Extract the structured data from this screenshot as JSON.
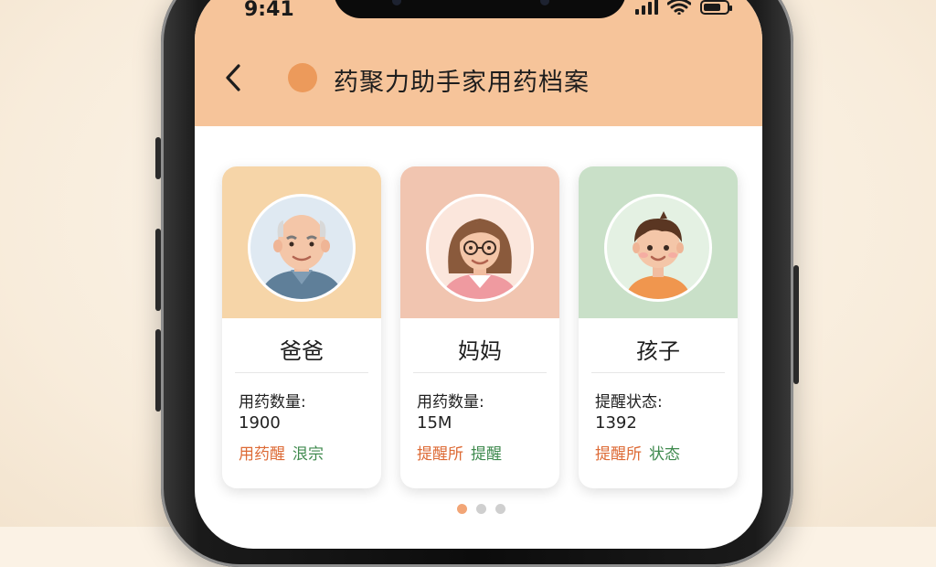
{
  "status_bar": {
    "time": "9:41"
  },
  "header": {
    "title": "药聚力助手家用药档案",
    "accent": "#ec9a5b",
    "background": "#f6c49a"
  },
  "cards": [
    {
      "name": "爸爸",
      "label": "用药数量:",
      "value": "1900",
      "tag_a": "用药醒",
      "tag_b": "泿宗",
      "bg": "#f6d5a8"
    },
    {
      "name": "妈妈",
      "label": "用药数量:",
      "value": "15M",
      "tag_a": "提醒所",
      "tag_b": "提醒",
      "bg": "#f1c5b0"
    },
    {
      "name": "孩子",
      "label": "提醒状态:",
      "value": "1392",
      "tag_a": "提醒所",
      "tag_b": "状态",
      "bg": "#c9e0c8"
    }
  ],
  "pagination": {
    "count": 3,
    "active": 1
  },
  "icons": [
    "back-chevron-icon",
    "signal-icon",
    "wifi-icon",
    "battery-icon"
  ]
}
